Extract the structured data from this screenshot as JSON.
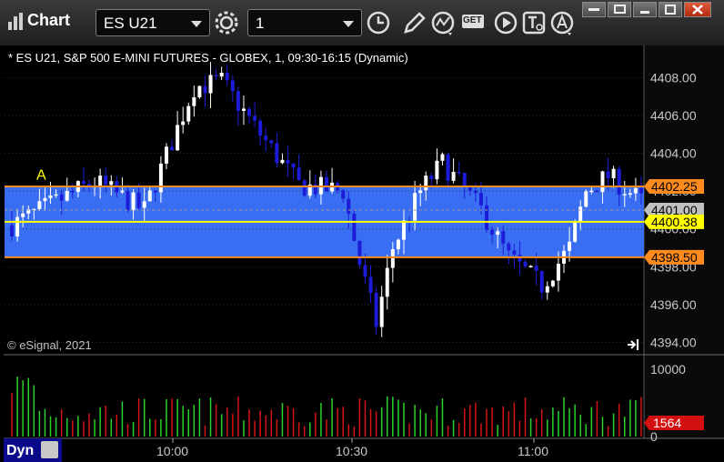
{
  "window": {
    "title": "Chart"
  },
  "toolbar": {
    "symbol": "ES U21",
    "interval": "1",
    "get_label": "GET"
  },
  "chart_header": "* ES U21, S&P 500 E-MINI FUTURES - GLOBEX, 1, 09:30-16:15 (Dynamic)",
  "copyright": "© eSignal, 2021",
  "volume_pane": {
    "label": "Dyn"
  },
  "colors": {
    "up": "#ffffff",
    "down": "#1c1cd8",
    "band": "#3a6ef2",
    "line_orange": "#ff8a1e",
    "line_yellow": "#ffff00",
    "vol_up": "#2bd12b",
    "vol_down": "#d41414"
  },
  "chart_data": {
    "type": "candlestick",
    "price_axis": {
      "ticks": [
        "4408.00",
        "4406.00",
        "4404.00",
        "4402.00",
        "4400.00",
        "4398.00",
        "4396.00",
        "4394.00"
      ],
      "range": [
        4393.4,
        4409.7
      ]
    },
    "volume_axis": {
      "ticks": [
        "10000",
        "0"
      ],
      "max": 12000
    },
    "time_axis": {
      "labels": [
        "10:00",
        "10:30",
        "11:00"
      ]
    },
    "levels": [
      {
        "price": 4402.25,
        "label": "4402.25",
        "kind": "orange"
      },
      {
        "price": 4401.0,
        "label": "4401.00",
        "kind": "last"
      },
      {
        "price": 4400.38,
        "label": "4400.38",
        "kind": "yellow"
      },
      {
        "price": 4398.5,
        "label": "4398.50",
        "kind": "orange"
      }
    ],
    "band": [
      4398.5,
      4402.25
    ],
    "marker": {
      "text": "A",
      "price": 4402.5
    },
    "last_volume": "1564"
  }
}
